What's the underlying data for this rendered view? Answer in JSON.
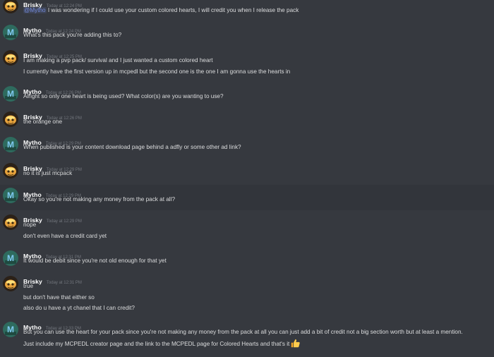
{
  "colors": {
    "background": "#36393f",
    "author": "#ffffff",
    "timestamp": "#72767d",
    "text": "#dcddde",
    "mention": "#7289da",
    "brisky_avatar": "#e8a33c",
    "mytho_avatar": "#2e6b5e"
  },
  "messages": [
    {
      "author": "Brisky",
      "time": "Today at 12:24 PM",
      "avatar_icon": "brisky-avatar-icon",
      "lines": [
        {
          "mention": "@Mytho",
          "text": " I was wondering if I could use your custom colored hearts, I will credit you when I release the pack"
        }
      ]
    },
    {
      "author": "Mytho",
      "time": "Today at 12:24 PM",
      "avatar_icon": "mytho-avatar-icon",
      "lines": [
        {
          "text": "What's this pack you're adding this to?"
        }
      ]
    },
    {
      "author": "Brisky",
      "time": "Today at 12:25 PM",
      "avatar_icon": "brisky-avatar-icon",
      "lines": [
        {
          "text": "I am making a pvp pack/ survival and I just wanted a custom colored heart"
        },
        {
          "text": "I currently have the first version up in mcpedl but the second one is the one I am gonna use the hearts in"
        }
      ]
    },
    {
      "author": "Mytho",
      "time": "Today at 12:26 PM",
      "avatar_icon": "mytho-avatar-icon",
      "lines": [
        {
          "text": "Alright so only one heart is being used? What color(s) are you wanting to use?"
        }
      ]
    },
    {
      "author": "Brisky",
      "time": "Today at 12:26 PM",
      "avatar_icon": "brisky-avatar-icon",
      "lines": [
        {
          "text": "the orange one"
        }
      ]
    },
    {
      "author": "Mytho",
      "time": "Today at 12:29 PM",
      "avatar_icon": "mytho-avatar-icon",
      "lines": [
        {
          "text": "When published is your content download page behind a adfly or some other ad link?"
        }
      ]
    },
    {
      "author": "Brisky",
      "time": "Today at 12:29 PM",
      "avatar_icon": "brisky-avatar-icon",
      "lines": [
        {
          "text": "no it is just mcpack"
        }
      ]
    },
    {
      "author": "Mytho",
      "time": "Today at 12:29 PM",
      "avatar_icon": "mytho-avatar-icon",
      "highlighted": true,
      "lines": [
        {
          "text": "Okay so you're not making any money from the pack at all?"
        }
      ]
    },
    {
      "author": "Brisky",
      "time": "Today at 12:29 PM",
      "avatar_icon": "brisky-avatar-icon",
      "lines": [
        {
          "text": "nope"
        },
        {
          "text": "don't even have a credit card yet"
        }
      ]
    },
    {
      "author": "Mytho",
      "time": "Today at 12:31 PM",
      "avatar_icon": "mytho-avatar-icon",
      "lines": [
        {
          "text": "It would be debit since you're not old enough for that yet"
        }
      ]
    },
    {
      "author": "Brisky",
      "time": "Today at 12:31 PM",
      "avatar_icon": "brisky-avatar-icon",
      "lines": [
        {
          "text": "true"
        },
        {
          "text": "but don't have that either so"
        },
        {
          "text": "also do u have a yt chanel that I can credit?"
        }
      ]
    },
    {
      "author": "Mytho",
      "time": "Today at 12:33 PM",
      "avatar_icon": "mytho-avatar-icon",
      "lines": [
        {
          "text": "But you can use the heart for your pack since you're not making any money from the pack at all you can just add a bit of credit not a big section worth but at least a mention."
        },
        {
          "text": "Just include my MCPEDL creator page and the link to the MCPEDL page for Colored Hearts and that's it",
          "emoji": "thumbs-up-icon"
        }
      ]
    }
  ]
}
